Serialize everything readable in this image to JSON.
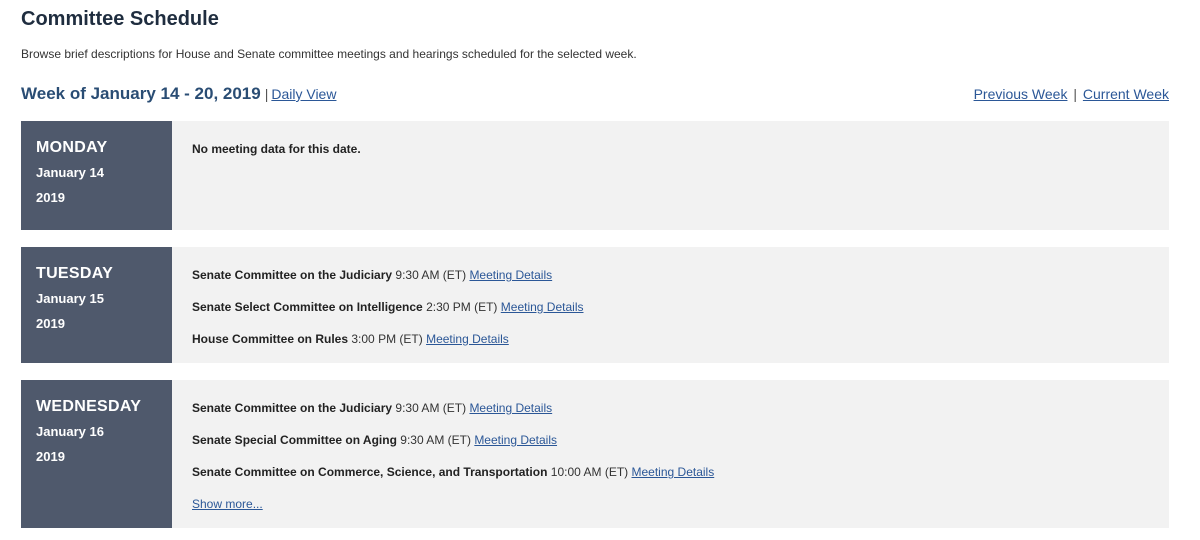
{
  "header": {
    "title": "Committee Schedule",
    "intro": "Browse brief descriptions for House and Senate committee meetings and hearings scheduled for the selected week."
  },
  "week": {
    "title": "Week of January 14 - 20, 2019",
    "separator": "|",
    "daily_view": "Daily View",
    "prev_week": "Previous Week",
    "current_week": "Current Week"
  },
  "days": [
    {
      "name": "MONDAY",
      "date": "January 14",
      "year": "2019",
      "no_data": "No meeting data for this date.",
      "meetings": []
    },
    {
      "name": "TUESDAY",
      "date": "January 15",
      "year": "2019",
      "meetings": [
        {
          "committee": "Senate Committee on the Judiciary",
          "time": "9:30 AM (ET)",
          "link": "Meeting Details"
        },
        {
          "committee": "Senate Select Committee on Intelligence",
          "time": "2:30 PM (ET)",
          "link": "Meeting Details"
        },
        {
          "committee": "House Committee on Rules",
          "time": "3:00 PM (ET)",
          "link": "Meeting Details"
        }
      ]
    },
    {
      "name": "WEDNESDAY",
      "date": "January 16",
      "year": "2019",
      "meetings": [
        {
          "committee": "Senate Committee on the Judiciary",
          "time": "9:30 AM (ET)",
          "link": "Meeting Details"
        },
        {
          "committee": "Senate Special Committee on Aging",
          "time": "9:30 AM (ET)",
          "link": "Meeting Details"
        },
        {
          "committee": "Senate Committee on Commerce, Science, and Transportation",
          "time": "10:00 AM (ET)",
          "link": "Meeting Details"
        }
      ],
      "show_more": "Show more..."
    }
  ],
  "colors": {
    "day_label_bg": "#4f596c",
    "day_panel_bg": "#f2f2f2",
    "link": "#2b5797",
    "title": "#1f2d3f",
    "week_title": "#2a4d74"
  }
}
